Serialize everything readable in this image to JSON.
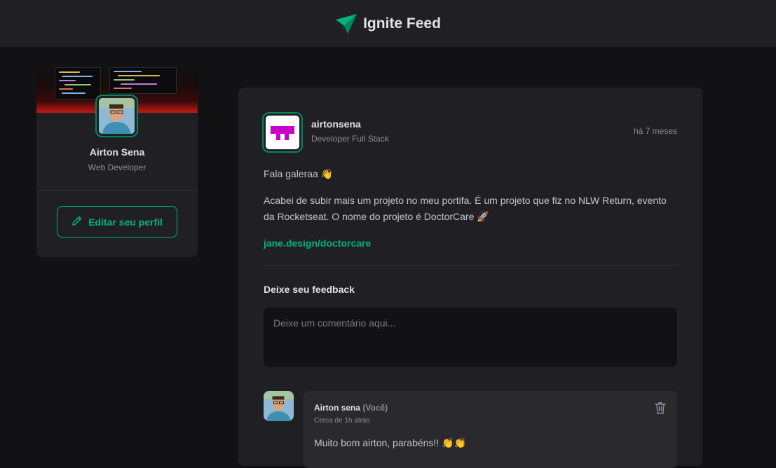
{
  "header": {
    "title": "Ignite Feed",
    "logo_icon": "paper-plane-icon",
    "accent": "#00b37e"
  },
  "sidebar": {
    "name": "Airton Sena",
    "role": "Web Developer",
    "edit_label": "Editar seu perfil",
    "edit_icon": "pencil-icon"
  },
  "post": {
    "author": "airtonsena",
    "role": "Developer Full Stack",
    "time": "há 7 meses",
    "paragraphs": [
      "Fala galeraa 👋",
      "Acabei de subir mais um projeto no meu portifa. É um projeto que fiz no NLW Return, evento da Rocketseat. O nome do projeto é DoctorCare 🚀"
    ],
    "link": "jane.design/doctorcare"
  },
  "feedback": {
    "title": "Deixe seu feedback",
    "placeholder": "Deixe um comentário aqui..."
  },
  "comment": {
    "author": "Airton sena",
    "you": "(Você)",
    "time": "Cerca de 1h atrás",
    "text": "Muito bom airton, parabéns!! 👏👏",
    "delete_icon": "trash-icon"
  },
  "colors": {
    "background": "#121214",
    "panel": "#202024",
    "comment_panel": "#29292e",
    "accent": "#00b37e",
    "avatar_border": "#00875f"
  }
}
